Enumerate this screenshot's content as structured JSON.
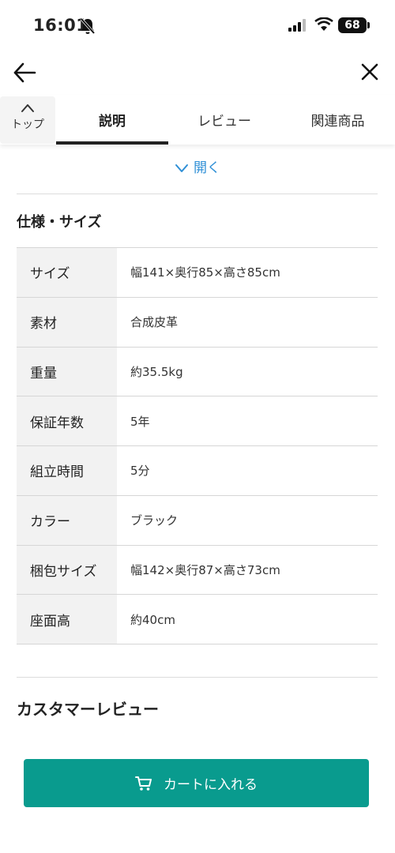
{
  "status_bar": {
    "time": "16:01",
    "battery": "68"
  },
  "tabs": {
    "top_label": "トップ",
    "items": [
      {
        "label": "説明",
        "active": true
      },
      {
        "label": "レビュー",
        "active": false
      },
      {
        "label": "関連商品",
        "active": false
      }
    ]
  },
  "open_link": "開く",
  "spec": {
    "title": "仕様・サイズ",
    "rows": [
      {
        "label": "サイズ",
        "value": "幅141×奥行85×高さ85cm"
      },
      {
        "label": "素材",
        "value": "合成皮革"
      },
      {
        "label": "重量",
        "value": "約35.5kg"
      },
      {
        "label": "保証年数",
        "value": "5年"
      },
      {
        "label": "組立時間",
        "value": "5分"
      },
      {
        "label": "カラー",
        "value": "ブラック"
      },
      {
        "label": "梱包サイズ",
        "value": "幅142×奥行87×高さ73cm"
      },
      {
        "label": "座面高",
        "value": "約40cm"
      }
    ]
  },
  "reviews": {
    "title": "カスタマーレビュー"
  },
  "cart": {
    "label": "カートに入れる"
  },
  "colors": {
    "accent": "#099b8e",
    "link": "#2e8fd6"
  }
}
